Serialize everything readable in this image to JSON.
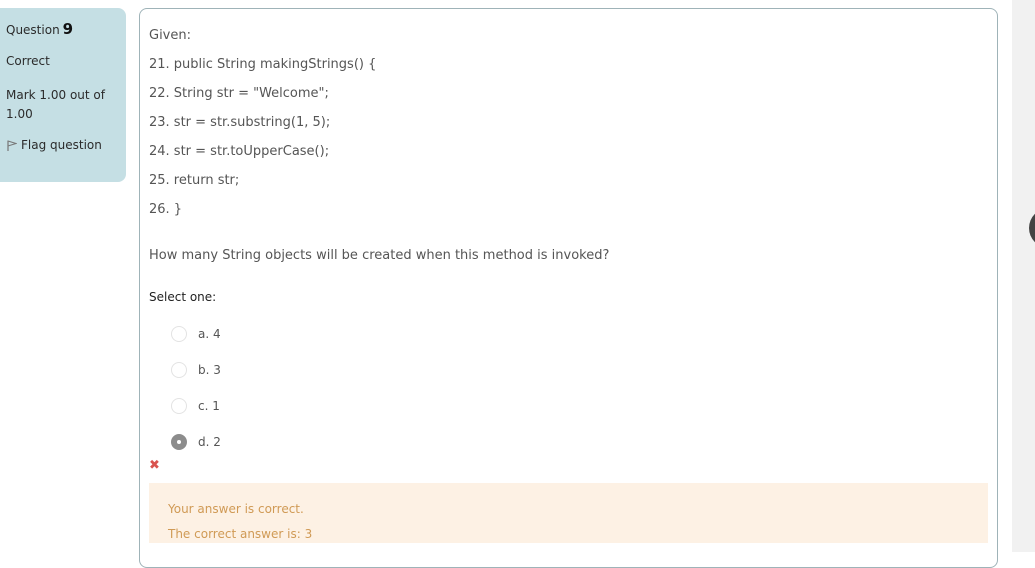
{
  "info": {
    "question_label": "Question",
    "question_number": "9",
    "state": "Correct",
    "grade": "Mark 1.00 out of 1.00",
    "flag_label": "Flag question"
  },
  "question": {
    "lines": [
      "Given:",
      "21. public String makingStrings() {",
      "22. String str = \"Welcome\";",
      "23. str = str.substring(1, 5);",
      "24. str = str.toUpperCase();",
      "25. return str;",
      "26. }"
    ],
    "text": "How many String objects will be created when this method is invoked?",
    "prompt": "Select one:",
    "options": [
      {
        "label": "a. 4",
        "selected": false
      },
      {
        "label": "b. 3",
        "selected": false
      },
      {
        "label": "c. 1",
        "selected": false
      },
      {
        "label": "d. 2",
        "selected": true
      }
    ],
    "result_mark": "✖"
  },
  "feedback": {
    "result": "Your answer is correct.",
    "correct_answer": "The correct answer is: 3"
  },
  "colors": {
    "info_bg": "#c5dfe4",
    "feedback_bg": "#fdf1e4",
    "feedback_text": "#d09a55",
    "incorrect_mark": "#d9534f"
  }
}
